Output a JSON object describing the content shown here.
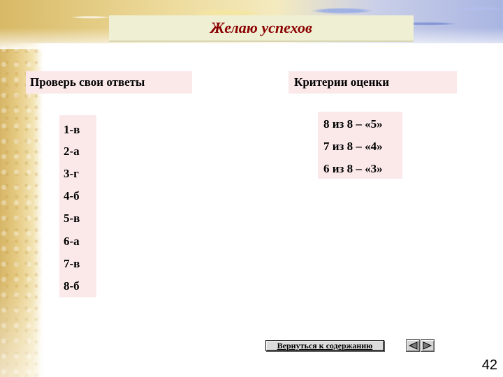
{
  "slide": {
    "title": "Желаю успехов",
    "page_number": "42"
  },
  "answers": {
    "header": "Проверь свои ответы",
    "items": [
      "1-в",
      "2-а",
      "3-г",
      "4-б",
      "5-в",
      "6-а",
      "7-в",
      "8-б"
    ]
  },
  "criteria": {
    "header": "Критерии оценки",
    "items": [
      "8 из 8 – «5»",
      "7 из 8 – «4»",
      "6 из 8 – «3»"
    ]
  },
  "navigation": {
    "back_label": "Вернуться к содержанию",
    "prev_icon": "left-arrow-icon",
    "next_icon": "right-arrow-icon"
  }
}
